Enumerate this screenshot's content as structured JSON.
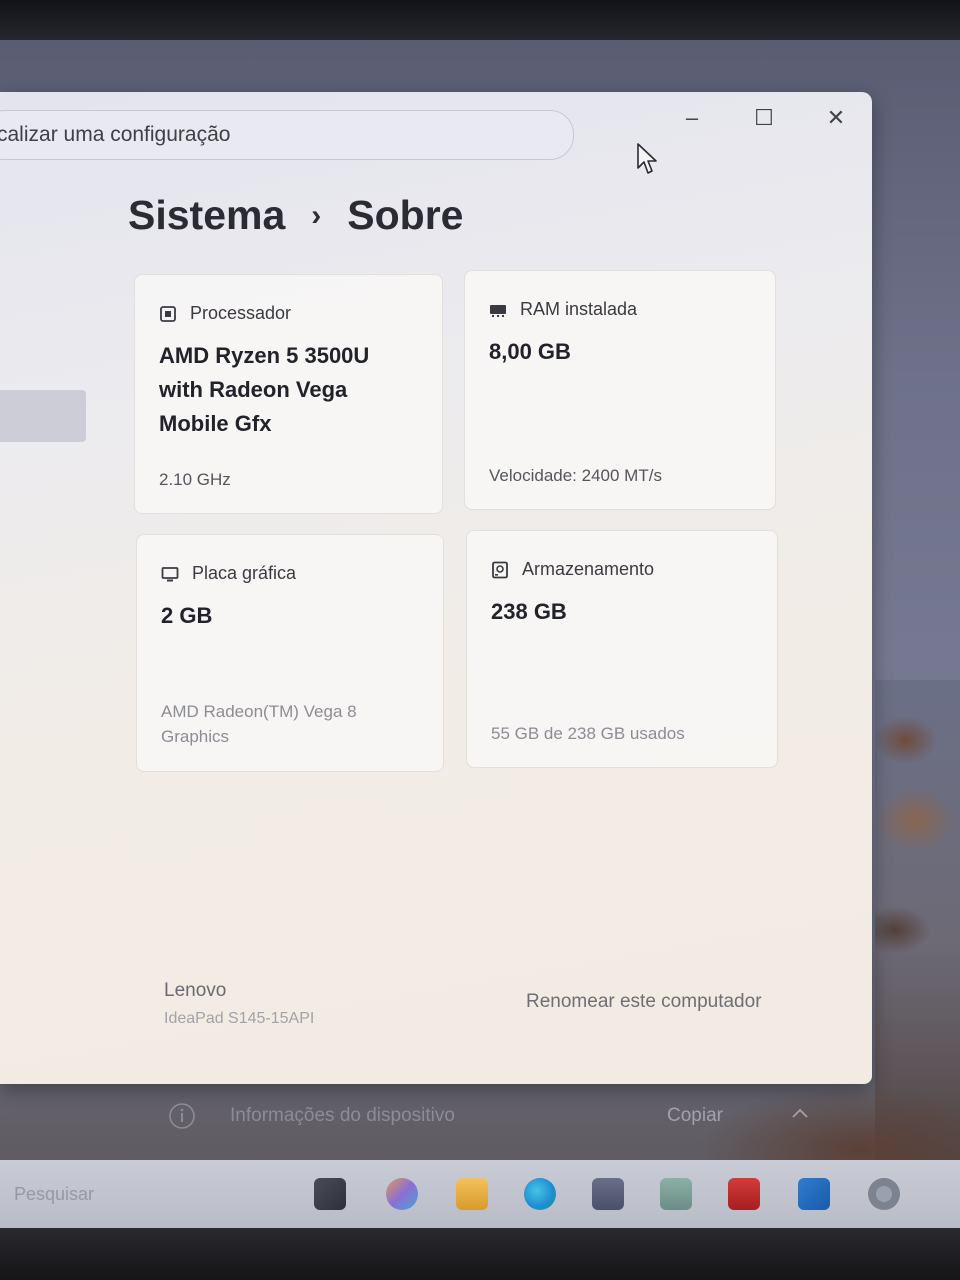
{
  "search": {
    "placeholder": "calizar uma configuração"
  },
  "window_controls": {
    "minimize": "–",
    "maximize": "☐",
    "close": "✕"
  },
  "breadcrumb": {
    "parent": "Sistema",
    "separator": "›",
    "current": "Sobre"
  },
  "specs": {
    "processor": {
      "label": "Processador",
      "value": "AMD Ryzen 5 3500U with Radeon Vega Mobile Gfx",
      "sub": "2.10 GHz"
    },
    "ram": {
      "label": "RAM instalada",
      "value": "8,00 GB",
      "sub": "Velocidade: 2400 MT/s"
    },
    "graphics": {
      "label": "Placa gráfica",
      "value": "2 GB",
      "sub": "AMD Radeon(TM) Vega 8 Graphics"
    },
    "storage": {
      "label": "Armazenamento",
      "value": "238 GB",
      "sub": "55 GB de 238 GB usados"
    }
  },
  "device": {
    "brand": "Lenovo",
    "model": "IdeaPad S145-15API",
    "rename_label": "Renomear este computador"
  },
  "device_info": {
    "label": "Informações do dispositivo",
    "copy_label": "Copiar"
  },
  "taskbar": {
    "search_placeholder": "Pesquisar",
    "apps": [
      "lenovo-vantage",
      "copilot",
      "file-explorer",
      "edge",
      "store",
      "lenovo-app",
      "mcafee",
      "outlook",
      "settings"
    ]
  },
  "colors": {
    "window_bg": "#f1ebe3",
    "text_primary": "#22232a",
    "text_muted": "#8c8c94"
  }
}
